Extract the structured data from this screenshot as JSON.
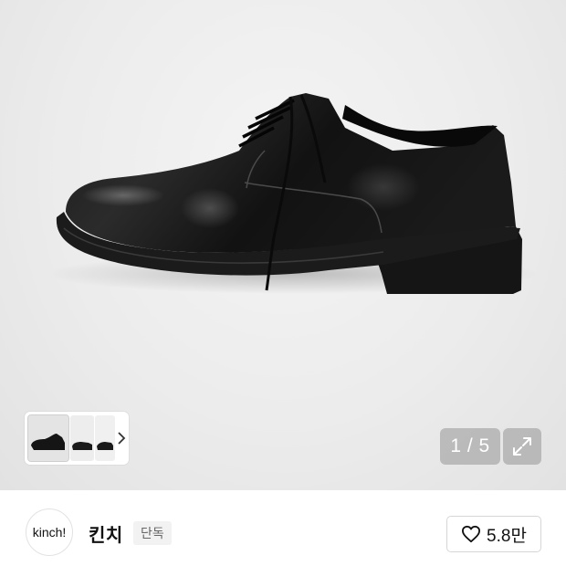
{
  "gallery": {
    "image_subject": "shoe-photo",
    "page_counter": "1 / 5",
    "thumbnail_count": 3
  },
  "seller": {
    "logo_text": "kinch!",
    "name": "킨치",
    "badge": "단독"
  },
  "like": {
    "count": "5.8만"
  },
  "colors": {
    "background": "#ececec",
    "overlay_button": "#9a9a9a",
    "text": "#111111",
    "badge_bg": "#f2f2f2"
  }
}
